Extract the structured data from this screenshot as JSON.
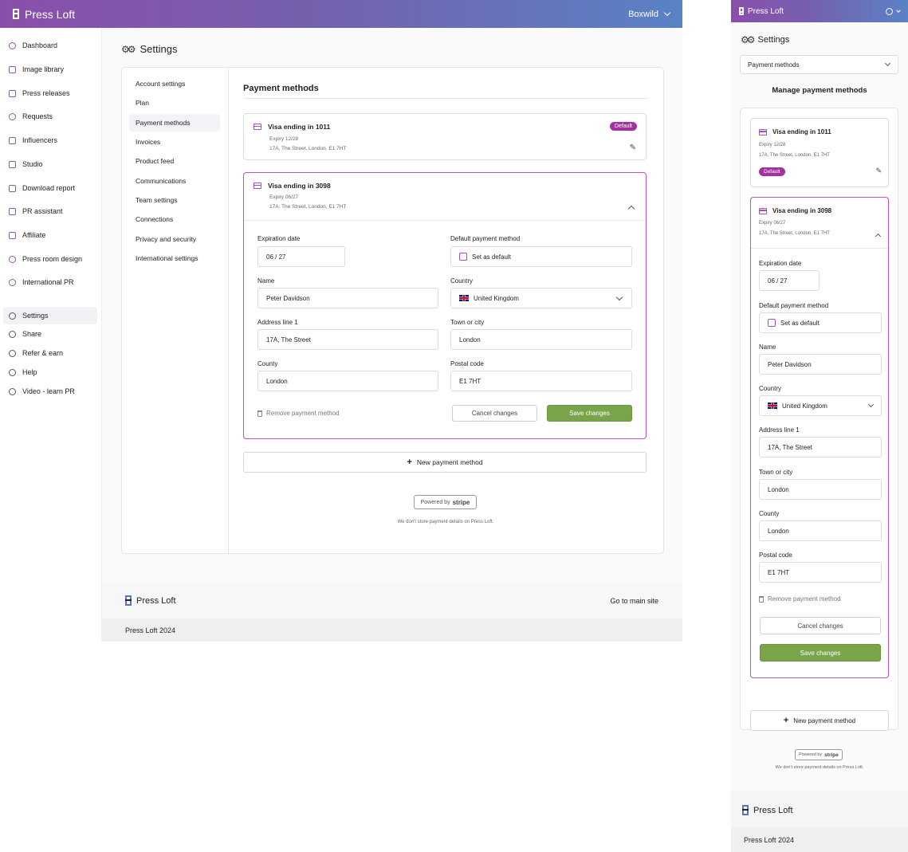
{
  "app": {
    "brand": "Press Loft",
    "account": "Boxwild"
  },
  "sidebar": {
    "items": [
      {
        "label": "Dashboard",
        "icon": "dashboard-icon"
      },
      {
        "label": "Image library",
        "icon": "image-icon"
      },
      {
        "label": "Press releases",
        "icon": "press-release-icon"
      },
      {
        "label": "Requests",
        "icon": "chat-icon"
      },
      {
        "label": "Influencers",
        "icon": "influencer-icon"
      },
      {
        "label": "Studio",
        "icon": "studio-icon"
      },
      {
        "label": "Download report",
        "icon": "chart-icon"
      },
      {
        "label": "PR assistant",
        "icon": "sparkle-icon"
      },
      {
        "label": "Affiliate",
        "icon": "affiliate-icon"
      },
      {
        "label": "Press room design",
        "icon": "palette-icon"
      },
      {
        "label": "International PR",
        "icon": "globe-icon"
      }
    ],
    "secondary": [
      {
        "label": "Settings",
        "icon": "gears-icon"
      },
      {
        "label": "Share",
        "icon": "share-icon"
      },
      {
        "label": "Refer & earn",
        "icon": "gift-icon"
      },
      {
        "label": "Help",
        "icon": "help-icon"
      },
      {
        "label": "Video - learn PR",
        "icon": "play-icon"
      }
    ]
  },
  "page": {
    "title": "Settings"
  },
  "settings_nav": [
    "Account settings",
    "Plan",
    "Payment methods",
    "Invoices",
    "Product feed",
    "Communications",
    "Team settings",
    "Connections",
    "Privacy and security",
    "International settings"
  ],
  "payment": {
    "title": "Payment methods",
    "mobile_heading": "Manage payment methods",
    "mobile_select": "Payment methods",
    "cards": [
      {
        "name": "Visa ending in 1011",
        "expiry": "Expiry 12/28",
        "address": "17A, The Street, London, E1 7HT",
        "badge": "Default"
      },
      {
        "name": "Visa ending in 3098",
        "expiry": "Expiry 06/27",
        "address": "17A, The Street, London, E1 7HT"
      }
    ],
    "form": {
      "expiration_label": "Expiration date",
      "expiration": "06 / 27",
      "default_label": "Default payment method",
      "default_checkbox": "Set as default",
      "name_label": "Name",
      "name": "Peter Davidson",
      "country_label": "Country",
      "country": "United Kingdom",
      "address_label": "Address line 1",
      "address": "17A, The Street",
      "town_label": "Town or city",
      "town": "London",
      "county_label": "County",
      "county": "London",
      "postal_label": "Postal code",
      "postal": "E1 7HT",
      "remove": "Remove payment method",
      "cancel": "Cancel changes",
      "save": "Save changes"
    },
    "new_method": "New payment method",
    "powered_by": "Powered by",
    "stripe": "stripe",
    "note": "We don't store payment details on Press Loft."
  },
  "footer": {
    "brand": "Press Loft",
    "link": "Go to main site",
    "copyright": "Press Loft 2024"
  }
}
